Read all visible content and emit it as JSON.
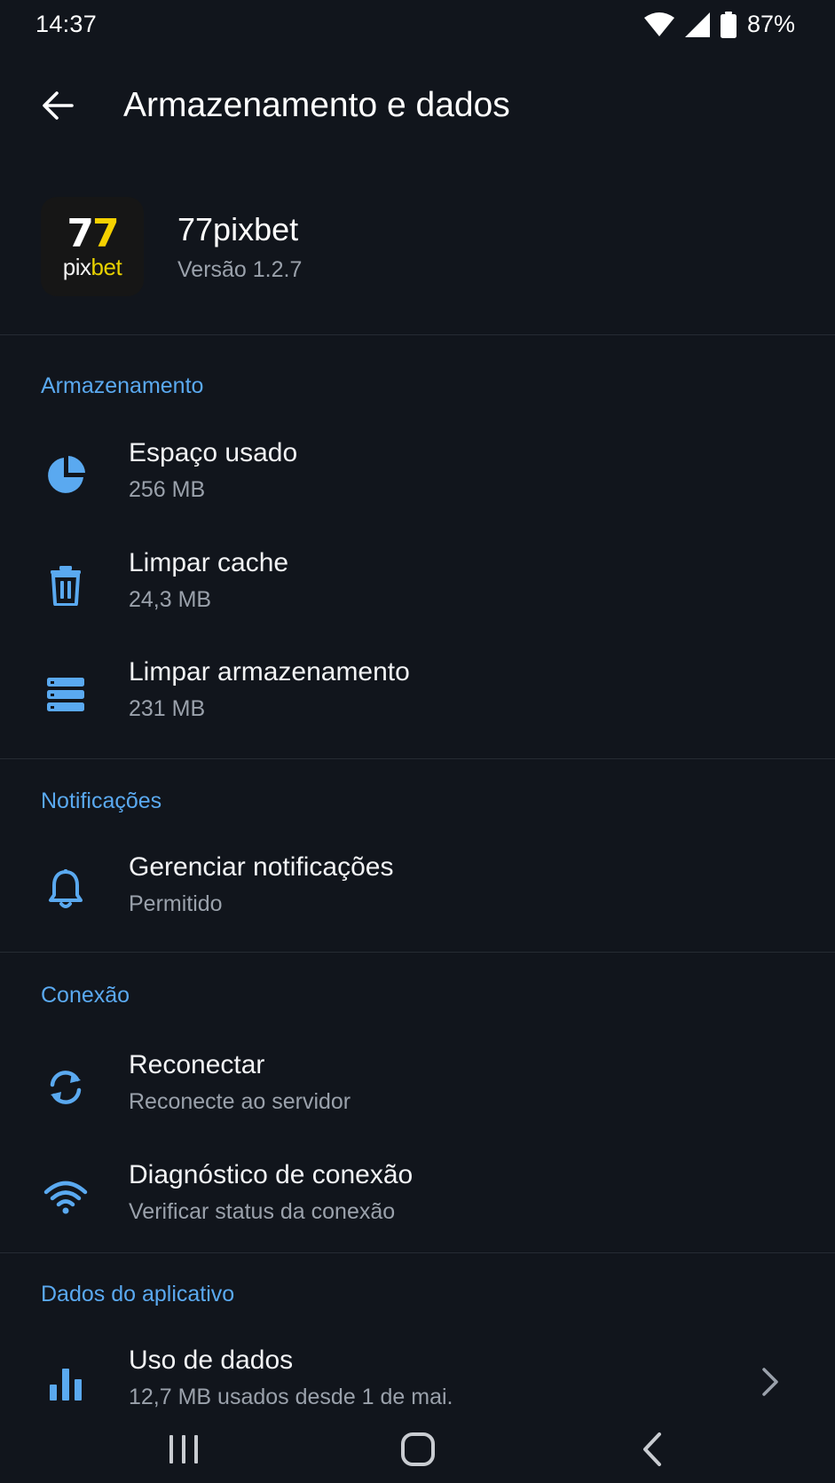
{
  "status_bar": {
    "time": "14:37",
    "battery": "87%",
    "icons": [
      "wifi-icon",
      "cellular-signal-icon",
      "battery-icon"
    ]
  },
  "header": {
    "back_icon": "arrow-left-icon",
    "title": "Armazenamento e dados"
  },
  "app": {
    "icon_text_top_white": "7",
    "icon_text_top_yellow": "7",
    "icon_text_bottom_white": "pix",
    "icon_text_bottom_yellow": "bet",
    "name": "77pixbet",
    "version": "Versão 1.2.7"
  },
  "sections": {
    "storage": {
      "header": "Armazenamento",
      "items": [
        {
          "icon": "pie-chart-icon",
          "title": "Espaço usado",
          "subtitle": "256 MB"
        },
        {
          "icon": "trash-icon",
          "title": "Limpar cache",
          "subtitle": "24,3 MB"
        },
        {
          "icon": "storage-icon",
          "title": "Limpar armazenamento",
          "subtitle": "231 MB"
        }
      ]
    },
    "notifications": {
      "header": "Notificações",
      "items": [
        {
          "icon": "bell-icon",
          "title": "Gerenciar notificações",
          "subtitle": "Permitido"
        }
      ]
    },
    "connection": {
      "header": "Conexão",
      "items": [
        {
          "icon": "sync-icon",
          "title": "Reconectar",
          "subtitle": "Reconecte ao servidor"
        },
        {
          "icon": "wifi-icon",
          "title": "Diagnóstico de conexão",
          "subtitle": "Verificar status da conexão"
        }
      ]
    },
    "app_data": {
      "header": "Dados do aplicativo",
      "items": [
        {
          "icon": "bar-chart-icon",
          "title": "Uso de dados",
          "subtitle": "12,7 MB usados desde 1 de mai.",
          "trailing_icon": "chevron-right-icon"
        }
      ]
    }
  },
  "nav_bar": {
    "buttons": [
      "recent-apps-icon",
      "home-icon",
      "back-icon"
    ]
  },
  "colors": {
    "background": "#11151c",
    "accent": "#5aa9f0",
    "primary_text": "#f2f3f5",
    "secondary_text": "#9aa1ab",
    "divider": "#262b33",
    "brand_yellow": "#f5d100"
  }
}
